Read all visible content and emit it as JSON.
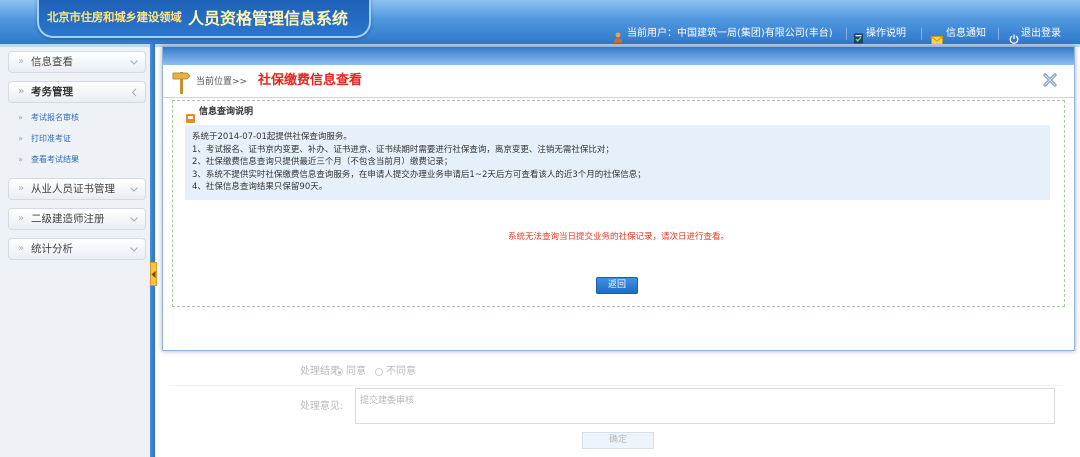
{
  "header": {
    "logo_sub": "北京市住房和城乡建设领域",
    "logo_title": "人员资格管理信息系统",
    "current_user": "当前用户：中国建筑一局(集团)有限公司(丰台)",
    "help": "操作说明",
    "notice": "信息通知",
    "logout": "退出登录",
    "icons": {
      "user": "user-icon",
      "help": "help-book-icon",
      "notice": "envelope-icon",
      "logout": "power-icon"
    }
  },
  "sidebar": {
    "items": [
      {
        "label": "信息查看",
        "expanded": false
      },
      {
        "label": "考务管理",
        "expanded": true,
        "children": [
          "考试报名审核",
          "打印准考证",
          "查看考试结果"
        ]
      },
      {
        "label": "从业人员证书管理",
        "expanded": false
      },
      {
        "label": "二级建造师注册",
        "expanded": false
      },
      {
        "label": "统计分析",
        "expanded": false
      }
    ]
  },
  "dialog": {
    "location_prefix": "当前位置>>",
    "title": "社保缴费信息查看",
    "section_title": "信息查询说明",
    "notes": [
      "系统于2014-07-01起提供社保查询服务。",
      "1、考试报名、证书京内变更、补办、证书进京、证书续期时需要进行社保查询，离京变更、注销无需社保比对；",
      "2、社保缴费信息查询只提供最近三个月（不包含当前月）缴费记录；",
      "3、系统不提供实时社保缴费信息查询服务，在申请人提交办理业务申请后1~2天后方可查看该人的近3个月的社保信息；",
      "4、社保信息查询结果只保留90天。"
    ],
    "warning": "系统无法查询当日提交业务的社保记录，请次日进行查看。",
    "back_button": "返回"
  },
  "background_form": {
    "result_label": "处理结果:",
    "options": [
      "同意",
      "不同意"
    ],
    "selected_index": 0,
    "opinion_label": "处理意见:",
    "opinion_value": "提交建委审核",
    "confirm_button": "确定"
  },
  "colors": {
    "header_blue": "#3d88d8",
    "title_red": "#e3261e",
    "warning_red": "#e83a2a",
    "link_blue": "#2a6cb8",
    "button_blue": "#2f7fd1"
  }
}
